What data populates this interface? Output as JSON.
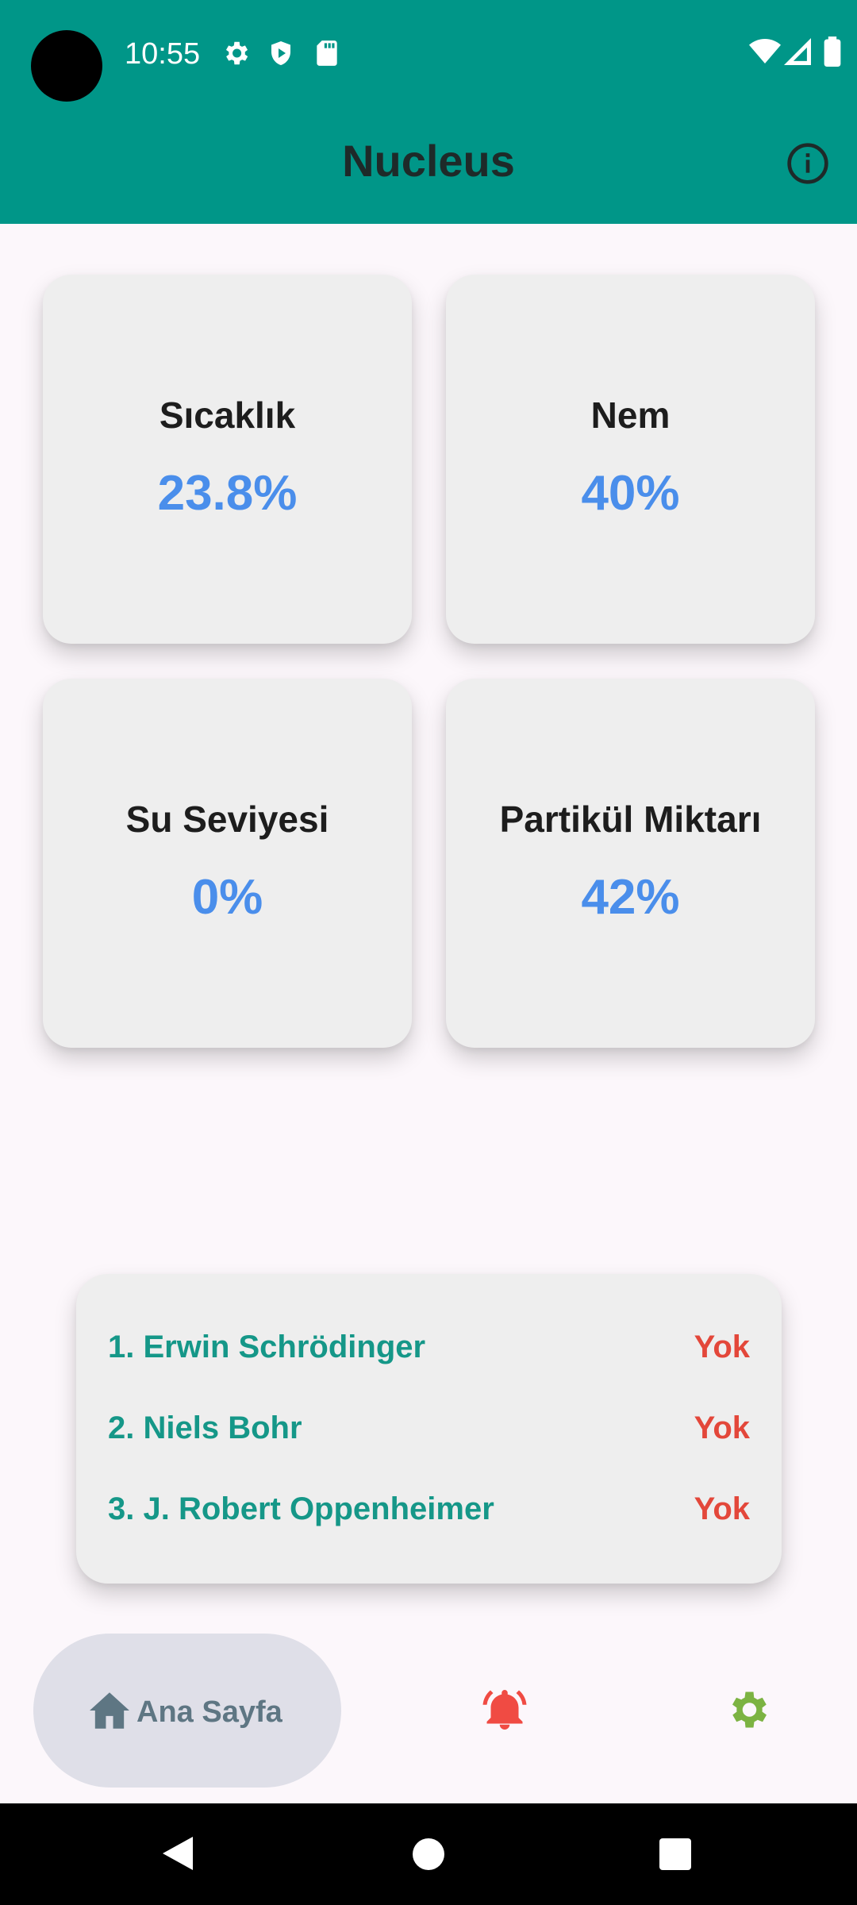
{
  "status_bar": {
    "time": "10:55",
    "left_icons": [
      "settings-icon",
      "shield-play-icon",
      "sd-card-icon"
    ],
    "right_icons": [
      "wifi-icon",
      "signal-icon",
      "battery-icon"
    ]
  },
  "app_bar": {
    "title": "Nucleus",
    "action_icon": "info-icon",
    "background_color": "#009688"
  },
  "sensors": [
    {
      "label": "Sıcaklık",
      "value": "23.8%"
    },
    {
      "label": "Nem",
      "value": "40%"
    },
    {
      "label": "Su Seviyesi",
      "value": "0%"
    },
    {
      "label": "Partikül Miktarı",
      "value": "42%"
    }
  ],
  "value_color": "#4A8EEB",
  "people": [
    {
      "name": "1. Erwin Schrödinger",
      "status": "Yok"
    },
    {
      "name": "2. Niels Bohr",
      "status": "Yok"
    },
    {
      "name": "3. J. Robert Oppenheimer",
      "status": "Yok"
    }
  ],
  "people_name_color": "#159788",
  "people_status_color": "#E3473A",
  "bottom_nav": {
    "home_label": "Ana Sayfa",
    "home_icon": "home-icon",
    "alarm_icon": "alarm-bell-icon",
    "settings_icon": "gear-icon",
    "alarm_color": "#F04B43",
    "settings_color": "#7CB342"
  },
  "system_nav": [
    "back-icon",
    "home-circle-icon",
    "recents-icon"
  ]
}
